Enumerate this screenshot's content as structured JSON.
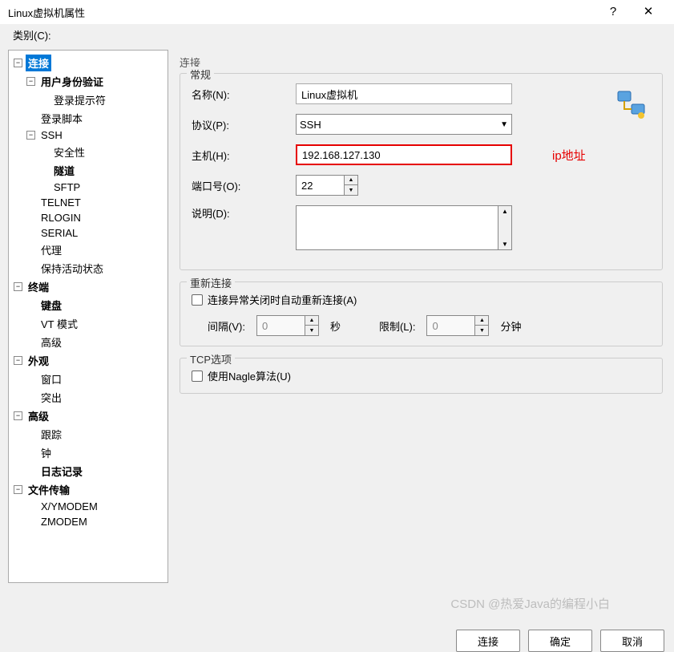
{
  "window": {
    "title": "Linux虚拟机属性",
    "help": "?",
    "close": "✕"
  },
  "category_label": "类别(C):",
  "tree": {
    "connection": "连接",
    "user_auth": "用户身份验证",
    "login_prompt": "登录提示符",
    "login_script": "登录脚本",
    "ssh": "SSH",
    "security": "安全性",
    "tunnel": "隧道",
    "sftp": "SFTP",
    "telnet": "TELNET",
    "rlogin": "RLOGIN",
    "serial": "SERIAL",
    "proxy": "代理",
    "keep_alive": "保持活动状态",
    "terminal": "终端",
    "keyboard": "键盘",
    "vt_mode": "VT 模式",
    "advanced_t": "高级",
    "appearance": "外观",
    "window": "窗口",
    "highlight": "突出",
    "advanced": "高级",
    "trace": "跟踪",
    "bell": "钟",
    "logging": "日志记录",
    "file_transfer": "文件传输",
    "xymodem": "X/YMODEM",
    "zmodem": "ZMODEM"
  },
  "panel_header": "连接",
  "general": {
    "legend": "常规",
    "name_label": "名称(N):",
    "name_value": "Linux虚拟机",
    "protocol_label": "协议(P):",
    "protocol_value": "SSH",
    "host_label": "主机(H):",
    "host_value": "192.168.127.130",
    "port_label": "端口号(O):",
    "port_value": "22",
    "desc_label": "说明(D):",
    "desc_value": ""
  },
  "annotation": "ip地址",
  "reconnect": {
    "legend": "重新连接",
    "checkbox_label": "连接异常关闭时自动重新连接(A)",
    "interval_label": "间隔(V):",
    "interval_value": "0",
    "interval_unit": "秒",
    "limit_label": "限制(L):",
    "limit_value": "0",
    "limit_unit": "分钟"
  },
  "tcp": {
    "legend": "TCP选项",
    "nagle_label": "使用Nagle算法(U)"
  },
  "buttons": {
    "connect": "连接",
    "ok": "确定",
    "cancel": "取消"
  },
  "watermark": "CSDN @热爱Java的编程小白"
}
